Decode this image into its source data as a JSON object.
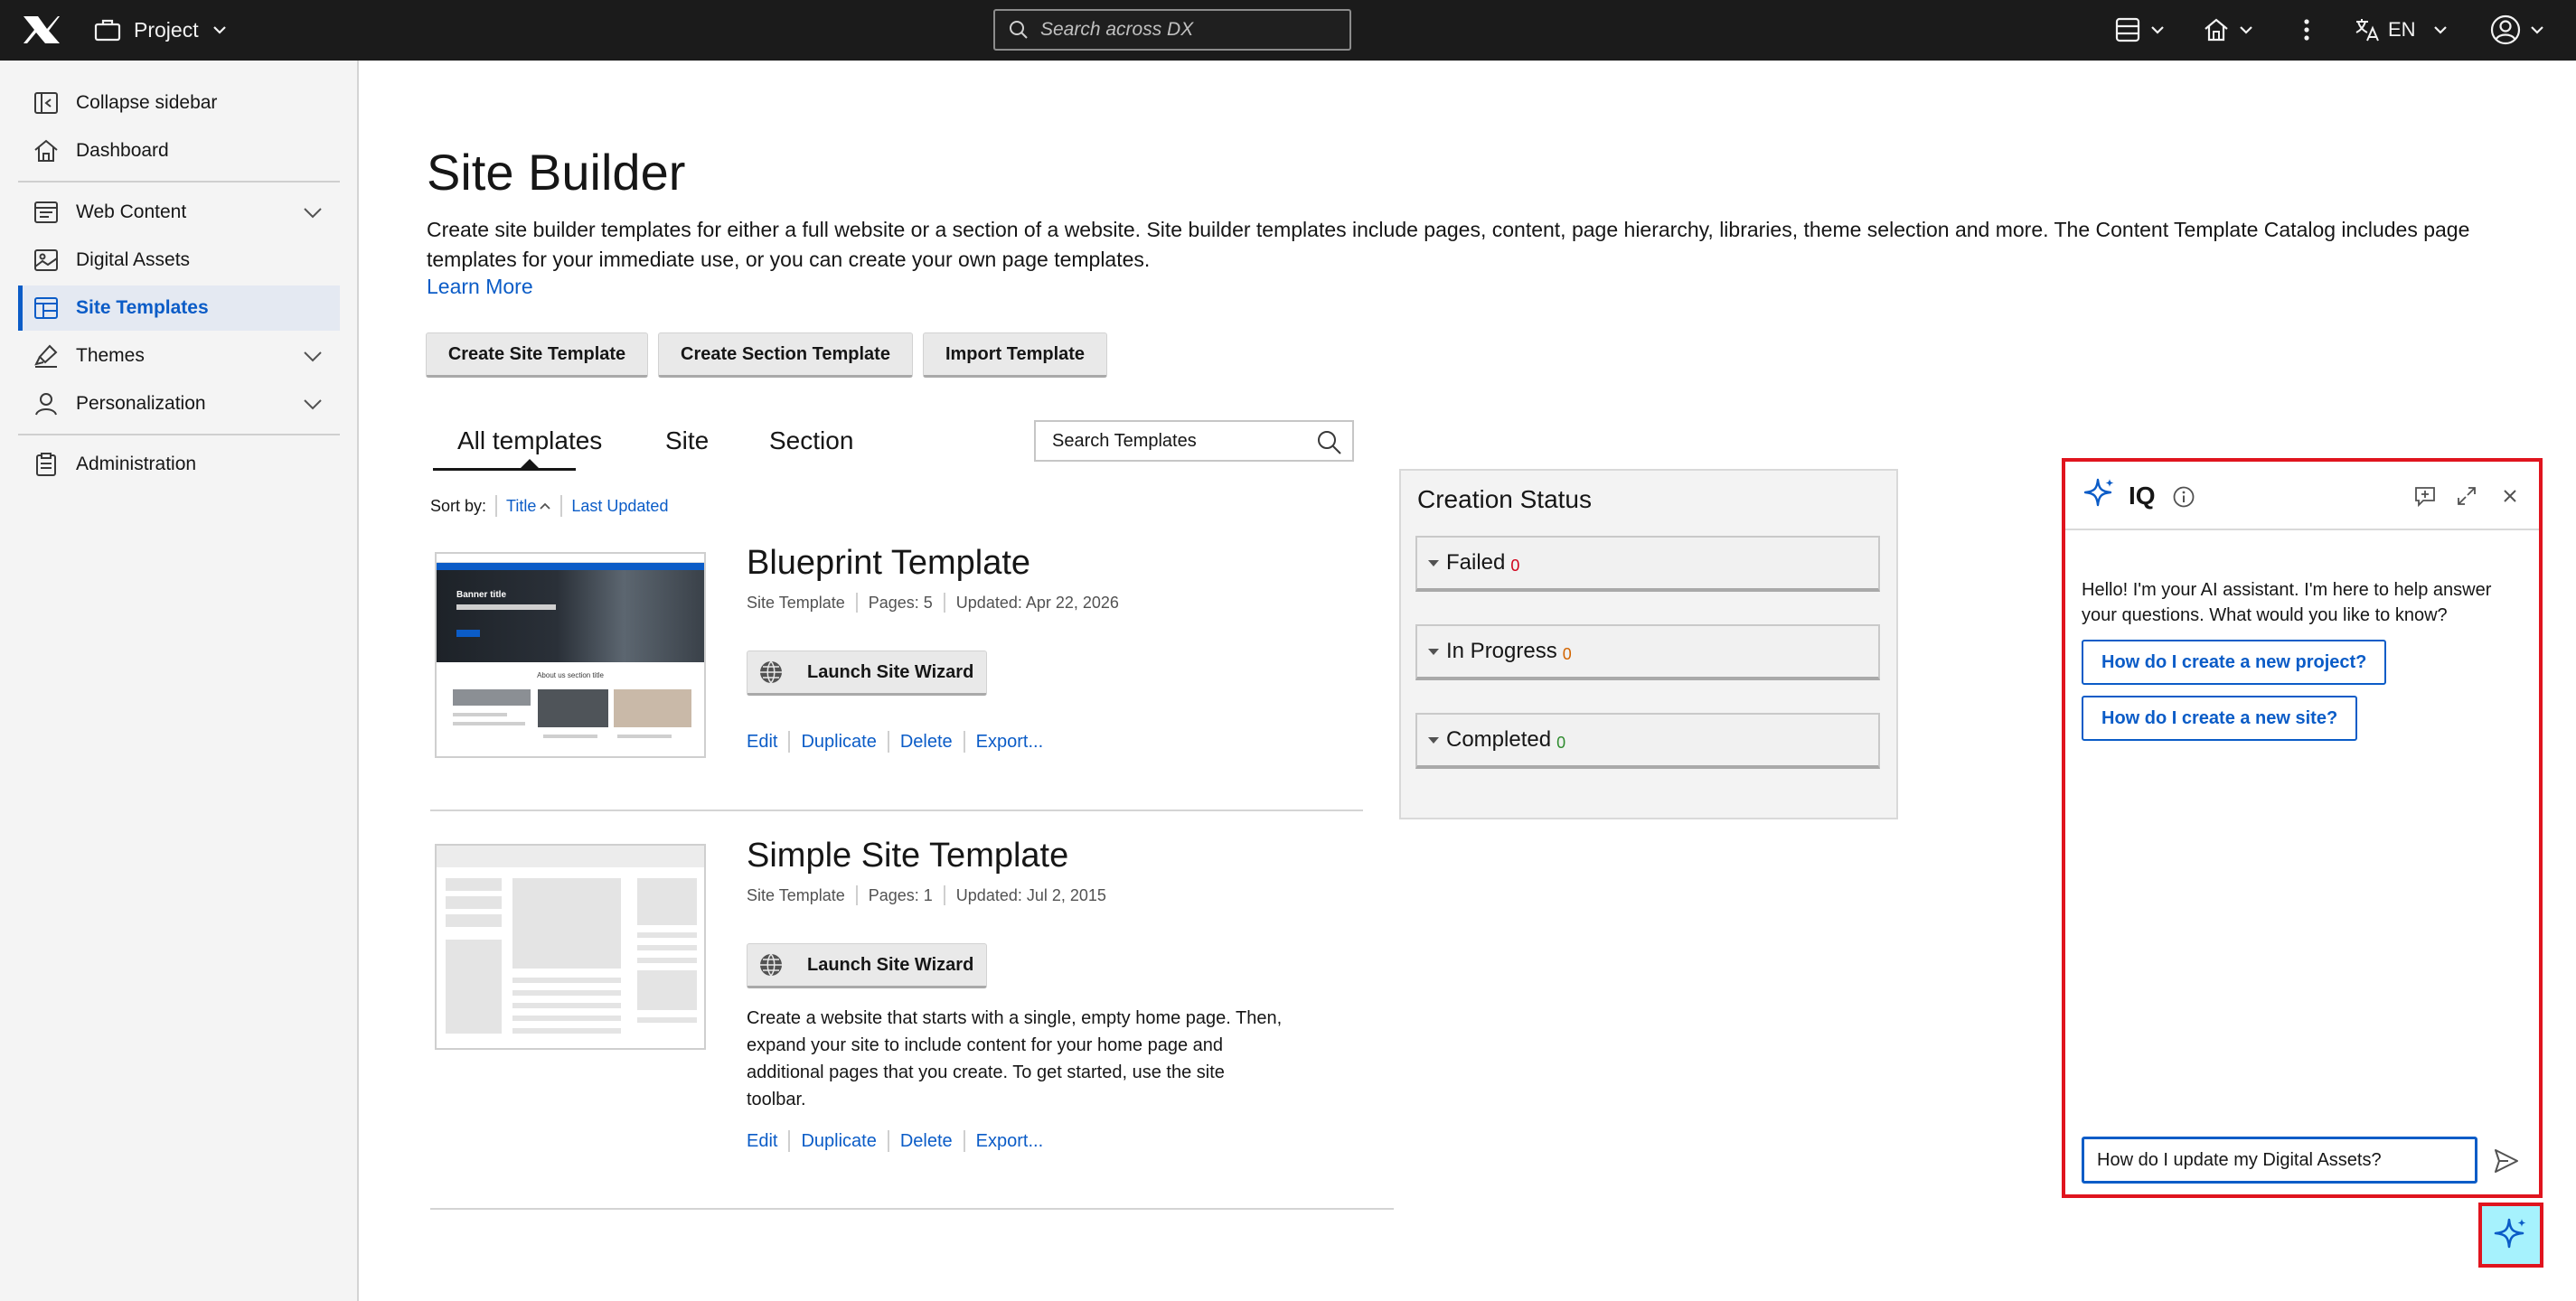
{
  "topbar": {
    "project_label": "Project",
    "search_placeholder": "Search across DX",
    "language": "EN"
  },
  "sidebar": {
    "collapse_label": "Collapse sidebar",
    "items": [
      {
        "label": "Dashboard",
        "icon": "home-icon"
      },
      {
        "label": "Web Content",
        "icon": "web-content-icon"
      },
      {
        "label": "Digital Assets",
        "icon": "image-icon"
      },
      {
        "label": "Site Templates",
        "icon": "template-icon",
        "active": true
      },
      {
        "label": "Themes",
        "icon": "paintbrush-icon"
      },
      {
        "label": "Personalization",
        "icon": "user-icon"
      },
      {
        "label": "Administration",
        "icon": "clipboard-icon"
      }
    ]
  },
  "main": {
    "title": "Site Builder",
    "description": "Create site builder templates for either a full website or a section of a website. Site builder templates include pages, content, page hierarchy, libraries, theme selection and more. The Content Template Catalog includes page templates for your immediate use, or you can create your own page templates.",
    "learn_more": "Learn More",
    "buttons": {
      "create_site": "Create Site Template",
      "create_section": "Create Section Template",
      "import": "Import Template"
    },
    "tabs": [
      "All templates",
      "Site",
      "Section"
    ],
    "search_templates": "Search Templates",
    "sort": {
      "label": "Sort by:",
      "title": "Title",
      "last_updated": "Last Updated"
    },
    "templates": [
      {
        "title": "Blueprint Template",
        "type": "Site Template",
        "pages": "Pages: 5",
        "updated": "Updated: Apr 22, 2026",
        "wizard": "Launch Site Wizard",
        "actions": [
          "Edit",
          "Duplicate",
          "Delete",
          "Export..."
        ],
        "thumb_banner_title": "Banner title",
        "thumb_section_title": "About us section title"
      },
      {
        "title": "Simple Site Template",
        "type": "Site Template",
        "pages": "Pages: 1",
        "updated": "Updated: Jul 2, 2015",
        "wizard": "Launch Site Wizard",
        "description": "Create a website that starts with a single, empty home page. Then, expand your site to include content for your home page and additional pages that you create. To get started, use the site toolbar.",
        "actions": [
          "Edit",
          "Duplicate",
          "Delete",
          "Export..."
        ]
      }
    ]
  },
  "creation_status": {
    "title": "Creation Status",
    "rows": [
      {
        "label": "Failed",
        "count": "0",
        "color": "#d0021b"
      },
      {
        "label": "In Progress",
        "count": "0",
        "color": "#d26400"
      },
      {
        "label": "Completed",
        "count": "0",
        "color": "#2e8b2e"
      }
    ]
  },
  "iq_panel": {
    "title": "IQ",
    "greeting": "Hello! I'm your AI assistant. I'm here to help answer your questions. What would you like to know?",
    "suggestions": [
      "How do I create a new project?",
      "How do I create a new site?"
    ],
    "input_value": "How do I update my Digital Assets?"
  },
  "colors": {
    "accent": "#0b5cc7",
    "highlight": "#e0141e",
    "topbar": "#1b1b1b"
  }
}
